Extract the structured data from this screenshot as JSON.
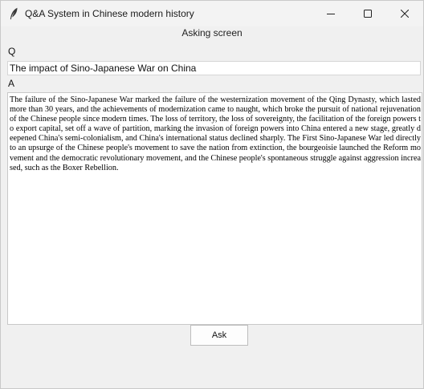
{
  "window": {
    "title": "Q&A System in Chinese modern history",
    "app_icon": "feather-icon",
    "controls": {
      "minimize_icon": "minimize-icon",
      "maximize_icon": "maximize-icon",
      "close_icon": "close-icon"
    }
  },
  "heading": "Asking screen",
  "question": {
    "label": "Q",
    "value": "The impact of Sino-Japanese War on China"
  },
  "answer": {
    "label": "A",
    "text": "The failure of the Sino-Japanese War marked the failure of the westernization movement of the Qing Dynasty, which lasted more than 30 years, and the achievements of modernization came to naught, which broke the pursuit of national rejuvenation of the Chinese people since modern times. The loss of territory, the loss of sovereignty, the facilitation of the foreign powers to export capital, set off a wave of partition, marking the invasion of foreign powers into China entered a new stage, greatly deepened China's semi-colonialism, and China's international status declined sharply. The First Sino-Japanese War led directly to an upsurge of the Chinese people's movement to save the nation from extinction, the bourgeoisie launched the Reform movement and the democratic revolutionary movement, and the Chinese people's spontaneous struggle against aggression increased, such as the Boxer Rebellion."
  },
  "ask_button": {
    "label": "Ask"
  }
}
